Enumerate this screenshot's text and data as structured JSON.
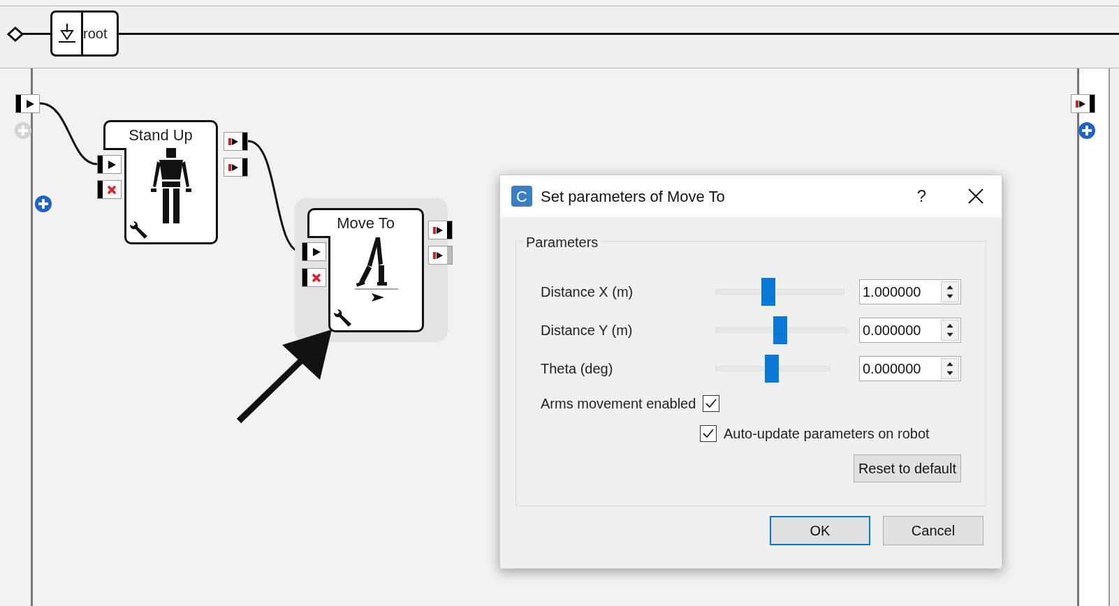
{
  "breadcrumb": {
    "label": "root"
  },
  "boxes": [
    {
      "kind": "robot",
      "title": "Stand Up",
      "selected": false
    },
    {
      "kind": "walk",
      "title": "Move To",
      "selected": true
    }
  ],
  "dialog": {
    "icon_letter": "C",
    "title": "Set parameters of Move To",
    "help": "?",
    "group": "Parameters",
    "params": [
      {
        "kind": "slider",
        "label": "Distance X (m)",
        "level": 0.4,
        "value": "1.000000"
      },
      {
        "kind": "slider",
        "label": "Distance Y (m)",
        "level": 0.49,
        "value": "0.000000"
      },
      {
        "kind": "slider",
        "label": "Theta (deg)",
        "level": 0.49,
        "value": "0.000000"
      },
      {
        "kind": "checkbox",
        "label": "Arms movement enabled",
        "checked": true
      }
    ],
    "auto_update": {
      "label": "Auto-update parameters on robot",
      "checked": true
    },
    "reset": "Reset to default",
    "buttons": [
      {
        "label": "OK",
        "default": true
      },
      {
        "label": "Cancel",
        "default": false
      }
    ]
  }
}
